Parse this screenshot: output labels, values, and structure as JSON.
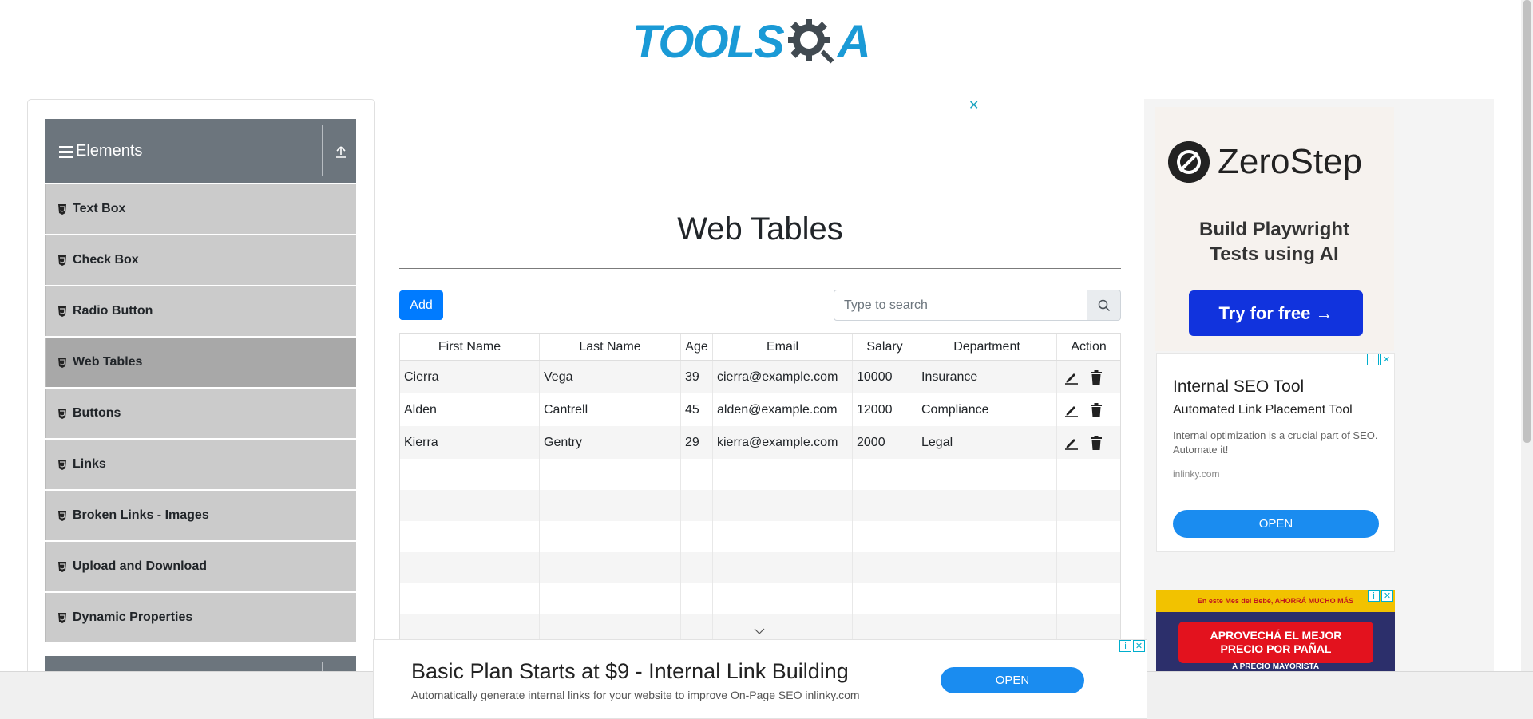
{
  "header": {
    "logo_text_blue": "TOOLS",
    "logo_text_dark": "A"
  },
  "sidebar": {
    "group_title": "Elements",
    "items": [
      {
        "label": "Text Box",
        "active": false
      },
      {
        "label": "Check Box",
        "active": false
      },
      {
        "label": "Radio Button",
        "active": false
      },
      {
        "label": "Web Tables",
        "active": true
      },
      {
        "label": "Buttons",
        "active": false
      },
      {
        "label": "Links",
        "active": false
      },
      {
        "label": "Broken Links - Images",
        "active": false
      },
      {
        "label": "Upload and Download",
        "active": false
      },
      {
        "label": "Dynamic Properties",
        "active": false
      }
    ]
  },
  "main": {
    "title": "Web Tables",
    "add_label": "Add",
    "search_placeholder": "Type to search",
    "columns": [
      "First Name",
      "Last Name",
      "Age",
      "Email",
      "Salary",
      "Department",
      "Action"
    ],
    "rows": [
      {
        "first": "Cierra",
        "last": "Vega",
        "age": "39",
        "email": "cierra@example.com",
        "salary": "10000",
        "department": "Insurance"
      },
      {
        "first": "Alden",
        "last": "Cantrell",
        "age": "45",
        "email": "alden@example.com",
        "salary": "12000",
        "department": "Compliance"
      },
      {
        "first": "Kierra",
        "last": "Gentry",
        "age": "29",
        "email": "kierra@example.com",
        "salary": "2000",
        "department": "Legal"
      }
    ]
  },
  "right_ads": {
    "zerostep": {
      "name": "ZeroStep",
      "tagline_1": "Build Playwright",
      "tagline_2": "Tests using AI",
      "cta": "Try for free →"
    },
    "seo": {
      "title": "Internal SEO Tool",
      "subtitle": "Automated Link Placement Tool",
      "body": "Internal optimization is a crucial part of SEO. Automate it!",
      "domain": "inlinky.com",
      "cta": "OPEN"
    },
    "promo": {
      "top": "En este Mes del Bebé, AHORRÁ MUCHO MÁS",
      "main_1": "APROVECHÁ EL MEJOR",
      "main_2": "PRECIO POR PAÑAL",
      "sub": "A PRECIO MAYORISTA"
    }
  },
  "bottom_ad": {
    "headline": "Basic Plan Starts at $9 - Internal Link Building",
    "sub": "Automatically generate internal links for your website to improve On-Page SEO inlinky.com",
    "cta": "OPEN"
  },
  "colors": {
    "brand_blue": "#1a9ad6",
    "sidebar_header": "#6c757d",
    "menu_item": "#cbcbcb",
    "menu_item_active": "#a8a8a8",
    "primary_button": "#007bff"
  }
}
